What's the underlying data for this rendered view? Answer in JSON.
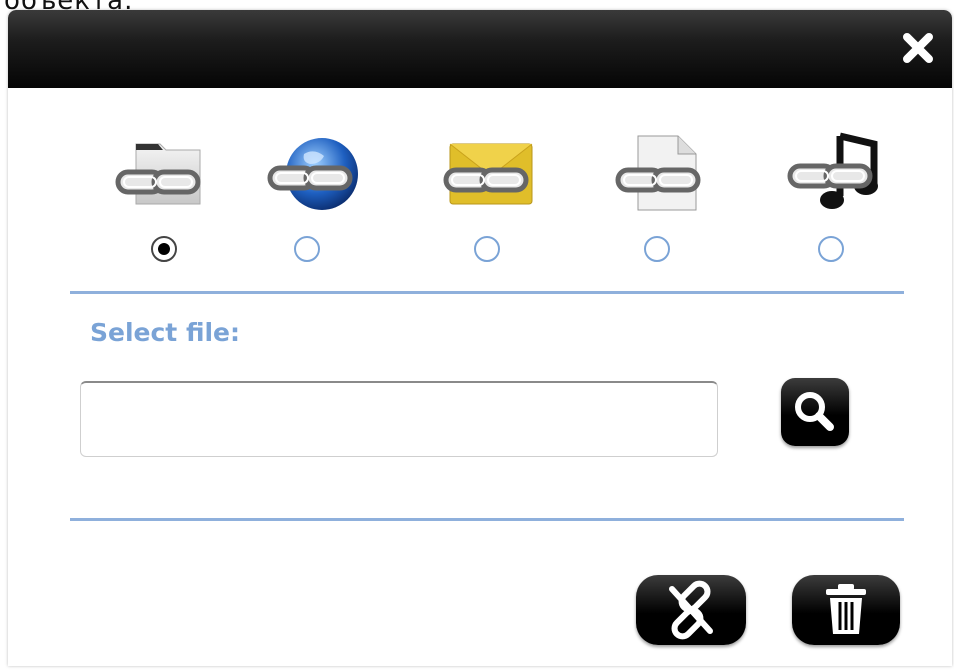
{
  "page": {
    "top_caption": "объекта."
  },
  "dialog": {
    "title": "",
    "close_icon": "close-icon"
  },
  "link_types": [
    {
      "icon": "folder-link-icon",
      "selected": true
    },
    {
      "icon": "web-link-icon",
      "selected": false
    },
    {
      "icon": "email-link-icon",
      "selected": false
    },
    {
      "icon": "file-link-icon",
      "selected": false
    },
    {
      "icon": "media-link-icon",
      "selected": false
    }
  ],
  "file_select": {
    "label": "Select file:",
    "value": "",
    "placeholder": ""
  },
  "actions": {
    "search_icon": "search-icon",
    "link_icon": "unlink-icon",
    "delete_icon": "trash-icon"
  },
  "colors": {
    "accent": "#7aa3d6",
    "titlebar": "#0a0a0a",
    "button": "#000000"
  }
}
